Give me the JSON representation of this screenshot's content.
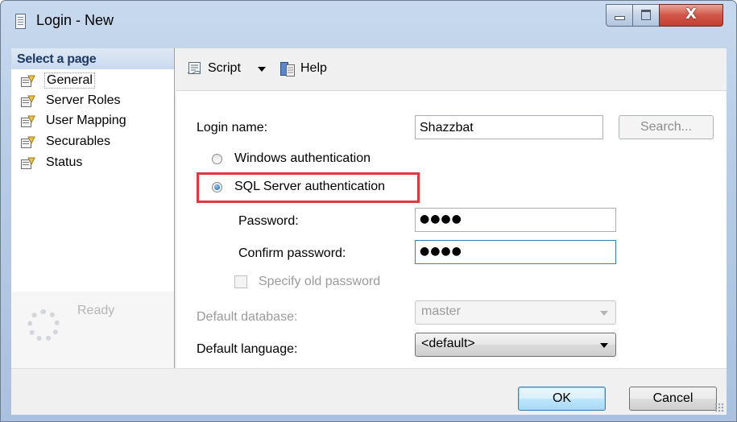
{
  "window": {
    "title": "Login - New",
    "controls": {
      "minimize": "minimize",
      "maximize": "maximize",
      "close": "X"
    }
  },
  "left_pane": {
    "header": "Select a page",
    "pages": [
      {
        "label": "General",
        "selected": true
      },
      {
        "label": "Server Roles"
      },
      {
        "label": "User Mapping"
      },
      {
        "label": "Securables"
      },
      {
        "label": "Status"
      }
    ],
    "progress_status": "Ready"
  },
  "toolbar": {
    "script_label": "Script",
    "help_label": "Help"
  },
  "form": {
    "login_name_label": "Login name:",
    "login_name_value": "Shazzbat",
    "search_button": "Search...",
    "windows_auth_label": "Windows authentication",
    "sql_auth_label": "SQL Server authentication",
    "auth_selected": "SQL Server authentication",
    "password_label": "Password:",
    "password_value": "●●●●",
    "confirm_password_label": "Confirm password:",
    "confirm_password_value": "●●●●",
    "specify_old_password_label": "Specify old password",
    "specify_old_password_checked": false,
    "default_database_label": "Default database:",
    "default_database_value": "master",
    "default_language_label": "Default language:",
    "default_language_value": "<default>"
  },
  "buttons": {
    "ok": "OK",
    "cancel": "Cancel"
  },
  "colors": {
    "highlight_box": "#e0383e",
    "close_button": "#c94b3c",
    "titlebar": "#b9cee7"
  },
  "icons": {
    "app": "document-icon",
    "page": "page-properties-icon",
    "script": "script-icon",
    "help": "help-icon"
  }
}
